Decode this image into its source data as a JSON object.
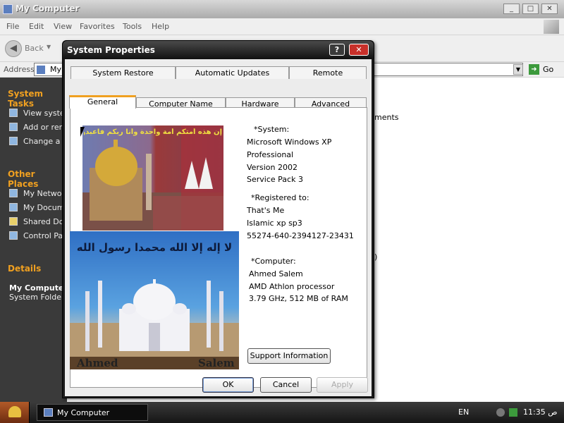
{
  "bg_window": {
    "title": "My Computer",
    "menu": [
      "File",
      "Edit",
      "View",
      "Favorites",
      "Tools",
      "Help"
    ],
    "back_label": "Back",
    "address_label": "Address",
    "address_value": "My",
    "go_label": "Go",
    "right_fragment": "ments",
    "right_fragment2": ")"
  },
  "sidebar": {
    "system_tasks_title": "System Tasks",
    "system_tasks": [
      "View system",
      "Add or rem",
      "Change a s"
    ],
    "other_places_title": "Other Places",
    "other_places": [
      "My Networ",
      "My Docume",
      "Shared Doc",
      "Control Par"
    ],
    "details_title": "Details",
    "details_name": "My Computer",
    "details_sub": "System Folder"
  },
  "dialog": {
    "title": "System Properties",
    "tabs_top": [
      "System Restore",
      "Automatic Updates",
      "Remote"
    ],
    "tabs_bottom": [
      "General",
      "Computer Name",
      "Hardware",
      "Advanced"
    ],
    "system_header": "*System:",
    "system_lines": [
      "Microsoft Windows XP",
      "Professional",
      "Version 2002",
      "Service Pack 3"
    ],
    "registered_header": "*Registered to:",
    "registered_lines": [
      "That's Me",
      "Islamic xp sp3",
      "55274-640-2394127-23431"
    ],
    "computer_header": "*Computer:",
    "computer_lines": [
      "Ahmed Salem",
      "AMD Athlon processor",
      "3.79 GHz, 512 MB of RAM"
    ],
    "support_button": "Support Information",
    "ok": "OK",
    "cancel": "Cancel",
    "apply": "Apply",
    "img1_caption": "إن هذه أمتكم أمة واحدة وأنا ربكم فاعبدون",
    "img2_caption": "لا إله إلا الله محمدا رسول الله",
    "img2_left": "Ahmed",
    "img2_right": "Salem"
  },
  "taskbar": {
    "task_label": "My Computer",
    "lang": "EN",
    "clock": "11:35 ص"
  }
}
